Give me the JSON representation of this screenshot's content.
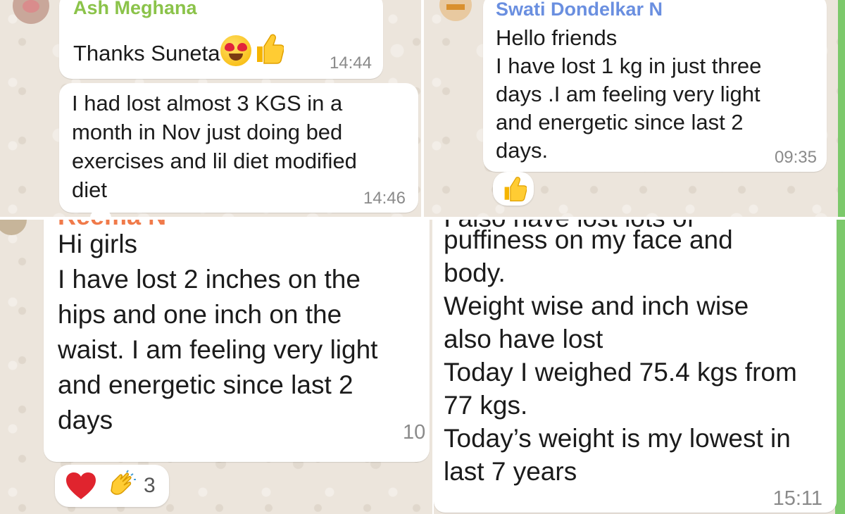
{
  "panels": {
    "top_left": {
      "sender": "Ash Meghana",
      "messages": [
        {
          "text": "Thanks Suneta",
          "time": "14:44",
          "emojis": [
            "heart-eyes-emoji",
            "thumbs-up-emoji"
          ]
        },
        {
          "text": "I had lost almost 3 KGS in a\nmonth in Nov just doing bed\nexercises and lil diet modified\ndiet",
          "time": "14:46"
        }
      ]
    },
    "top_right": {
      "sender": "Swati Dondelkar N",
      "message": {
        "text": "Hello friends\nI have lost 1 kg in just three\ndays .I am feeling very light\nand energetic since last 2\ndays.",
        "time": "09:35"
      },
      "reaction": {
        "icon": "thumbs-up-emoji"
      }
    },
    "bottom_left": {
      "sender": "Reema N",
      "message": {
        "text": "Hi girls\nI have lost 2 inches on the\nhips and one inch on the\nwaist. I am feeling very light\nand energetic since last 2\ndays",
        "time": "10"
      },
      "reactions": {
        "icons": [
          "heart-emoji",
          "clapping-hands-emoji"
        ],
        "count": "3"
      }
    },
    "bottom_right": {
      "partial_top_text": "I also have lost lots of",
      "message": {
        "text": "puffiness on my face and\nbody.\nWeight wise and inch wise\nalso have lost\nToday I weighed 75.4 kgs from\n77 kgs.\nToday’s weight is my lowest in\nlast 7 years",
        "time": "15:11"
      }
    }
  },
  "colors": {
    "chat_background": "#ece5dc",
    "bubble": "#ffffff",
    "sender_ash": "#8bc34a",
    "sender_swati": "#6a8fe0",
    "sender_reema": "#f07a4a",
    "timestamp": "#8a8a8a",
    "accent_green": "#7cc96b"
  }
}
